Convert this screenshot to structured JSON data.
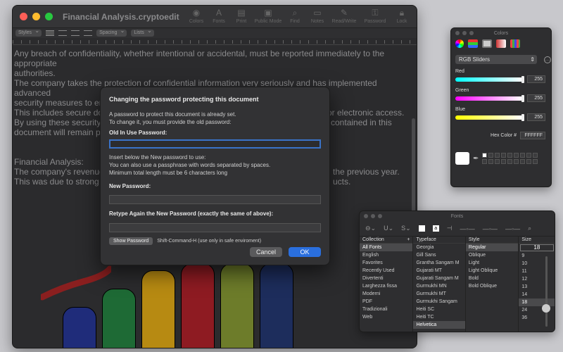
{
  "window": {
    "title": "Financial Analysis.cryptoedit",
    "toolbar": [
      {
        "label": "Colors",
        "icon": "colors-icon"
      },
      {
        "label": "Fonts",
        "icon": "fonts-icon"
      },
      {
        "label": "Print",
        "icon": "print-icon"
      },
      {
        "label": "Public Mode",
        "icon": "public-mode-icon"
      },
      {
        "label": "Find",
        "icon": "find-icon"
      },
      {
        "label": "Notes",
        "icon": "notes-icon"
      },
      {
        "label": "Read/Write",
        "icon": "read-write-icon"
      },
      {
        "label": "Password",
        "icon": "password-icon"
      },
      {
        "label": "Lock",
        "icon": "lock-icon"
      }
    ],
    "format": {
      "styles": "Styles",
      "spacing": "Spacing",
      "lists": "Lists"
    }
  },
  "document": {
    "lines": [
      "Any breach of confidentiality, whether intentional or accidental, must be reported immediately to the appropriate",
      "authorities.",
      "The company takes the protection of confidential information very seriously and has implemented advanced",
      "security measures to ensure that this information remains secure.",
      "This includes secure doc",
      "By using these security m",
      "document will remain pro"
    ],
    "right_fragments": [
      "or electronic access.",
      "n contained in this"
    ],
    "section_title": "Financial Analysis:",
    "section_lines": [
      "The company's revenue",
      "This was due to strong sa"
    ],
    "section_right": [
      "the previous year.",
      "ucts."
    ]
  },
  "dialog": {
    "title": "Changing the password protecting this document",
    "intro_1": "A password to protect this document is already set.",
    "intro_2": "To change it, you must provide the old password:",
    "old_label": "Old In Use Password:",
    "new_intro_1": "Insert below the New password to use:",
    "new_intro_2": "You can also use a passphrase with words separated by spaces.",
    "new_intro_3": "Minimum total length must be 6 characters long",
    "new_label": "New Password:",
    "retype_label": "Retype Again the New Password (exactly the same of above):",
    "show_button": "Show Password",
    "show_hint": "Shift-Command-H (use only in safe enviroment)",
    "cancel": "Cancel",
    "ok": "OK"
  },
  "colors": {
    "title": "Colors",
    "mode": "RGB Sliders",
    "red_label": "Red",
    "red": "255",
    "green_label": "Green",
    "green": "255",
    "blue_label": "Blue",
    "blue": "255",
    "hex_label": "Hex Color #",
    "hex": "FFFFFF"
  },
  "fonts": {
    "title": "Fonts",
    "collection_head": "Collection",
    "typeface_head": "Typeface",
    "style_head": "Style",
    "size_head": "Size",
    "size_value": "18",
    "collections": [
      "All Fonts",
      "English",
      "Favorites",
      "Recently Used",
      "Divertenti",
      "Larghezza fissa",
      "Moderni",
      "PDF",
      "Tradizionali",
      "Web"
    ],
    "typefaces": [
      "Georgia",
      "Gill Sans",
      "Grantha Sangam M",
      "Gujarati MT",
      "Gujarati Sangam M",
      "Gurmukhi MN",
      "Gurmukhi MT",
      "Gurmukhi Sangam",
      "Heiti SC",
      "Heiti TC",
      "Helvetica"
    ],
    "styles": [
      "Regular",
      "Oblique",
      "Light",
      "Light Oblique",
      "Bold",
      "Bold Oblique"
    ],
    "sizes": [
      "9",
      "10",
      "11",
      "12",
      "13",
      "14",
      "18",
      "24",
      "36"
    ]
  }
}
